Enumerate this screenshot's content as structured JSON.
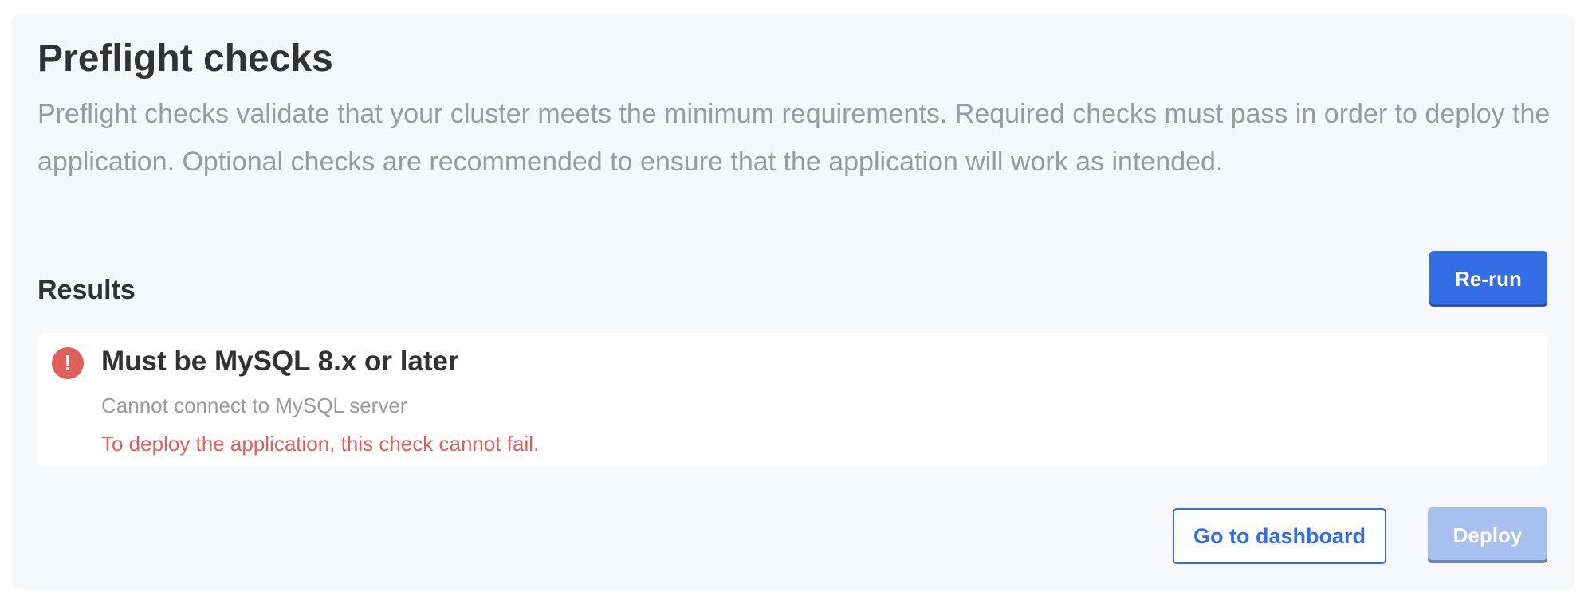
{
  "header": {
    "title": "Preflight checks",
    "description": "Preflight checks validate that your cluster meets the minimum requirements. Required checks must pass in order to deploy the application. Optional checks are recommended to ensure that the application will work as intended."
  },
  "results": {
    "heading": "Results",
    "rerun_label": "Re-run",
    "checks": [
      {
        "status": "fail",
        "icon": "exclamation-icon",
        "icon_glyph": "!",
        "title": "Must be MySQL 8.x or later",
        "message": "Cannot connect to MySQL server",
        "warning": "To deploy the application, this check cannot fail."
      }
    ]
  },
  "footer": {
    "dashboard_label": "Go to dashboard",
    "deploy_label": "Deploy",
    "deploy_disabled": true
  },
  "colors": {
    "accent": "#326de6",
    "error": "#e15f5b",
    "muted_text": "#9b9b9b",
    "panel_bg": "#f6f7f9",
    "disabled_button": "#a9bff0"
  }
}
